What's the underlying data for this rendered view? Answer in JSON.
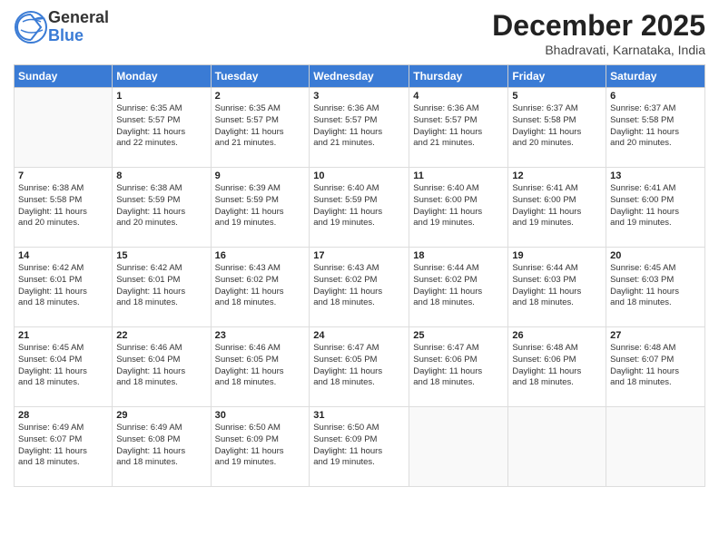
{
  "logo": {
    "general": "General",
    "blue": "Blue"
  },
  "title": "December 2025",
  "subtitle": "Bhadravati, Karnataka, India",
  "headers": [
    "Sunday",
    "Monday",
    "Tuesday",
    "Wednesday",
    "Thursday",
    "Friday",
    "Saturday"
  ],
  "weeks": [
    [
      {
        "day": "",
        "info": ""
      },
      {
        "day": "1",
        "info": "Sunrise: 6:35 AM\nSunset: 5:57 PM\nDaylight: 11 hours\nand 22 minutes."
      },
      {
        "day": "2",
        "info": "Sunrise: 6:35 AM\nSunset: 5:57 PM\nDaylight: 11 hours\nand 21 minutes."
      },
      {
        "day": "3",
        "info": "Sunrise: 6:36 AM\nSunset: 5:57 PM\nDaylight: 11 hours\nand 21 minutes."
      },
      {
        "day": "4",
        "info": "Sunrise: 6:36 AM\nSunset: 5:57 PM\nDaylight: 11 hours\nand 21 minutes."
      },
      {
        "day": "5",
        "info": "Sunrise: 6:37 AM\nSunset: 5:58 PM\nDaylight: 11 hours\nand 20 minutes."
      },
      {
        "day": "6",
        "info": "Sunrise: 6:37 AM\nSunset: 5:58 PM\nDaylight: 11 hours\nand 20 minutes."
      }
    ],
    [
      {
        "day": "7",
        "info": "Sunrise: 6:38 AM\nSunset: 5:58 PM\nDaylight: 11 hours\nand 20 minutes."
      },
      {
        "day": "8",
        "info": "Sunrise: 6:38 AM\nSunset: 5:59 PM\nDaylight: 11 hours\nand 20 minutes."
      },
      {
        "day": "9",
        "info": "Sunrise: 6:39 AM\nSunset: 5:59 PM\nDaylight: 11 hours\nand 19 minutes."
      },
      {
        "day": "10",
        "info": "Sunrise: 6:40 AM\nSunset: 5:59 PM\nDaylight: 11 hours\nand 19 minutes."
      },
      {
        "day": "11",
        "info": "Sunrise: 6:40 AM\nSunset: 6:00 PM\nDaylight: 11 hours\nand 19 minutes."
      },
      {
        "day": "12",
        "info": "Sunrise: 6:41 AM\nSunset: 6:00 PM\nDaylight: 11 hours\nand 19 minutes."
      },
      {
        "day": "13",
        "info": "Sunrise: 6:41 AM\nSunset: 6:00 PM\nDaylight: 11 hours\nand 19 minutes."
      }
    ],
    [
      {
        "day": "14",
        "info": "Sunrise: 6:42 AM\nSunset: 6:01 PM\nDaylight: 11 hours\nand 18 minutes."
      },
      {
        "day": "15",
        "info": "Sunrise: 6:42 AM\nSunset: 6:01 PM\nDaylight: 11 hours\nand 18 minutes."
      },
      {
        "day": "16",
        "info": "Sunrise: 6:43 AM\nSunset: 6:02 PM\nDaylight: 11 hours\nand 18 minutes."
      },
      {
        "day": "17",
        "info": "Sunrise: 6:43 AM\nSunset: 6:02 PM\nDaylight: 11 hours\nand 18 minutes."
      },
      {
        "day": "18",
        "info": "Sunrise: 6:44 AM\nSunset: 6:02 PM\nDaylight: 11 hours\nand 18 minutes."
      },
      {
        "day": "19",
        "info": "Sunrise: 6:44 AM\nSunset: 6:03 PM\nDaylight: 11 hours\nand 18 minutes."
      },
      {
        "day": "20",
        "info": "Sunrise: 6:45 AM\nSunset: 6:03 PM\nDaylight: 11 hours\nand 18 minutes."
      }
    ],
    [
      {
        "day": "21",
        "info": "Sunrise: 6:45 AM\nSunset: 6:04 PM\nDaylight: 11 hours\nand 18 minutes."
      },
      {
        "day": "22",
        "info": "Sunrise: 6:46 AM\nSunset: 6:04 PM\nDaylight: 11 hours\nand 18 minutes."
      },
      {
        "day": "23",
        "info": "Sunrise: 6:46 AM\nSunset: 6:05 PM\nDaylight: 11 hours\nand 18 minutes."
      },
      {
        "day": "24",
        "info": "Sunrise: 6:47 AM\nSunset: 6:05 PM\nDaylight: 11 hours\nand 18 minutes."
      },
      {
        "day": "25",
        "info": "Sunrise: 6:47 AM\nSunset: 6:06 PM\nDaylight: 11 hours\nand 18 minutes."
      },
      {
        "day": "26",
        "info": "Sunrise: 6:48 AM\nSunset: 6:06 PM\nDaylight: 11 hours\nand 18 minutes."
      },
      {
        "day": "27",
        "info": "Sunrise: 6:48 AM\nSunset: 6:07 PM\nDaylight: 11 hours\nand 18 minutes."
      }
    ],
    [
      {
        "day": "28",
        "info": "Sunrise: 6:49 AM\nSunset: 6:07 PM\nDaylight: 11 hours\nand 18 minutes."
      },
      {
        "day": "29",
        "info": "Sunrise: 6:49 AM\nSunset: 6:08 PM\nDaylight: 11 hours\nand 18 minutes."
      },
      {
        "day": "30",
        "info": "Sunrise: 6:50 AM\nSunset: 6:09 PM\nDaylight: 11 hours\nand 19 minutes."
      },
      {
        "day": "31",
        "info": "Sunrise: 6:50 AM\nSunset: 6:09 PM\nDaylight: 11 hours\nand 19 minutes."
      },
      {
        "day": "",
        "info": ""
      },
      {
        "day": "",
        "info": ""
      },
      {
        "day": "",
        "info": ""
      }
    ]
  ]
}
